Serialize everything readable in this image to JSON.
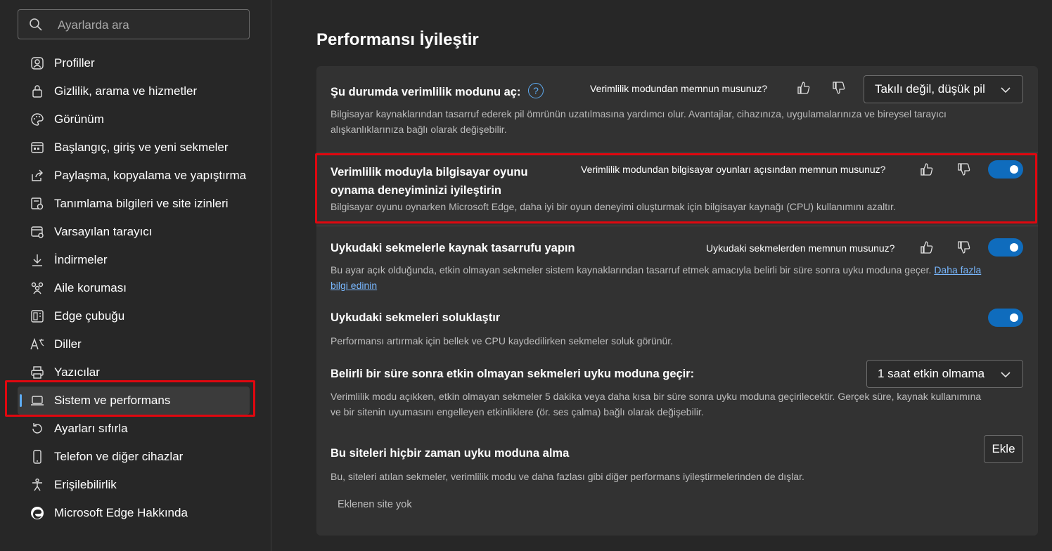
{
  "search": {
    "placeholder": "Ayarlarda ara"
  },
  "sidebar": {
    "items": [
      {
        "label": "Profiller",
        "icon": "profile-icon"
      },
      {
        "label": "Gizlilik, arama ve hizmetler",
        "icon": "lock-icon"
      },
      {
        "label": "Görünüm",
        "icon": "palette-icon"
      },
      {
        "label": "Başlangıç, giriş ve yeni sekmeler",
        "icon": "home-tabs-icon"
      },
      {
        "label": "Paylaşma, kopyalama ve yapıştırma",
        "icon": "share-icon"
      },
      {
        "label": "Tanımlama bilgileri ve site izinleri",
        "icon": "cookies-icon"
      },
      {
        "label": "Varsayılan tarayıcı",
        "icon": "browser-icon"
      },
      {
        "label": "İndirmeler",
        "icon": "download-icon"
      },
      {
        "label": "Aile koruması",
        "icon": "family-icon"
      },
      {
        "label": "Edge çubuğu",
        "icon": "edge-bar-icon"
      },
      {
        "label": "Diller",
        "icon": "languages-icon"
      },
      {
        "label": "Yazıcılar",
        "icon": "printer-icon"
      },
      {
        "label": "Sistem ve performans",
        "icon": "laptop-icon",
        "active": true
      },
      {
        "label": "Ayarları sıfırla",
        "icon": "reset-icon"
      },
      {
        "label": "Telefon ve diğer cihazlar",
        "icon": "phone-icon"
      },
      {
        "label": "Erişilebilirlik",
        "icon": "accessibility-icon"
      },
      {
        "label": "Microsoft Edge Hakkında",
        "icon": "edge-logo-icon"
      }
    ]
  },
  "main": {
    "title": "Performansı İyileştir",
    "efficiency": {
      "title": "Şu durumda verimlilik modunu aç:",
      "help": "?",
      "feedback_question": "Verimlilik modundan memnun musunuz?",
      "dropdown_value": "Takılı değil, düşük pil",
      "description": "Bilgisayar kaynaklarından tasarruf ederek pil ömrünün uzatılmasına yardımcı olur. Avantajlar, cihazınıza, uygulamalarınıza ve bireysel tarayıcı alışkanlıklarınıza bağlı olarak değişebilir."
    },
    "gaming": {
      "title_line1": "Verimlilik moduyla bilgisayar oyunu",
      "title_line2": "oynama deneyiminizi iyileştirin",
      "feedback_question": "Verimlilik modundan bilgisayar oyunları açısından memnun musunuz?",
      "description": "Bilgisayar oyunu oynarken Microsoft Edge, daha iyi bir oyun deneyimi oluşturmak için bilgisayar kaynağı (CPU) kullanımını azaltır.",
      "toggle_on": true
    },
    "sleeping_tabs": {
      "title": "Uykudaki sekmelerle kaynak tasarrufu yapın",
      "feedback_question": "Uykudaki sekmelerden memnun musunuz?",
      "description": "Bu ayar açık olduğunda, etkin olmayan sekmeler sistem kaynaklarından tasarruf etmek amacıyla belirli bir süre sonra uyku moduna geçer.",
      "link_part1": "Daha fazla",
      "link_part2": "bilgi edinin",
      "toggle_on": true
    },
    "fade_tabs": {
      "title": "Uykudaki sekmeleri soluklaştır",
      "description": "Performansı artırmak için bellek ve CPU kaydedilirken sekmeler soluk görünür.",
      "toggle_on": true
    },
    "sleep_timer": {
      "title": "Belirli bir süre sonra etkin olmayan sekmeleri uyku moduna geçir:",
      "dropdown_value": "1 saat etkin olmama",
      "description_line1": "Verimlilik modu açıkken, etkin olmayan sekmeler 5 dakika veya daha kısa bir süre sonra uyku moduna geçirilecektir. Gerçek süre, kaynak kullanımına",
      "description_line2": "ve bir sitenin uyumasını engelleyen etkinliklere (ör. ses çalma) bağlı olarak değişebilir."
    },
    "never_sleep": {
      "title": "Bu siteleri hiçbir zaman uyku moduna alma",
      "add_button": "Ekle",
      "description": "Bu, siteleri atılan sekmeler, verimlilik modu ve daha fazlası gibi diğer performans iyileştirmelerinden de dışlar.",
      "empty_text": "Eklenen site yok"
    }
  },
  "colors": {
    "accent": "#0f6cbd",
    "highlight": "#e0070f",
    "link": "#79b8ff"
  }
}
